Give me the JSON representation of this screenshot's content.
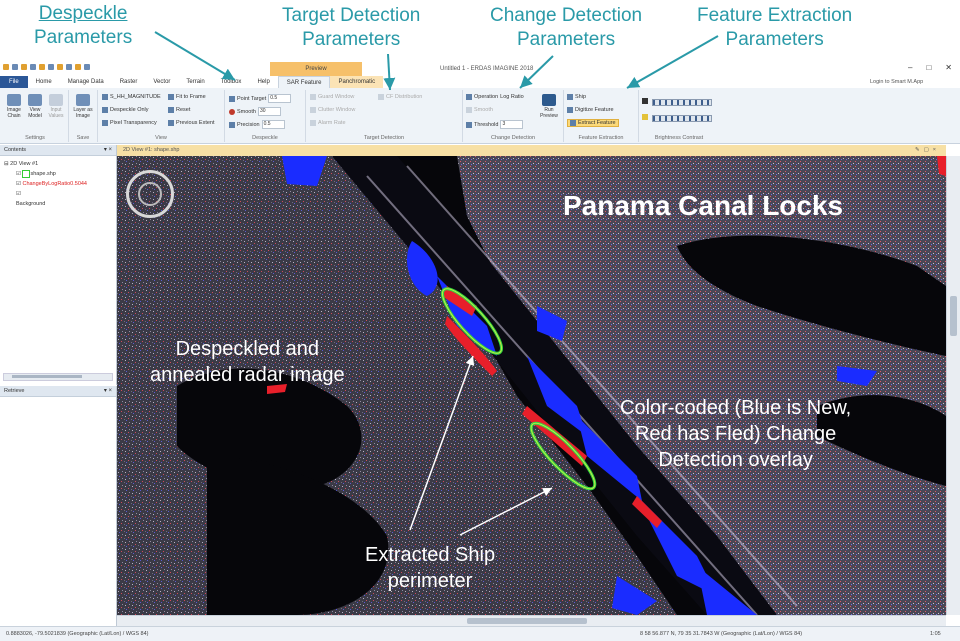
{
  "callouts": {
    "despeckle": [
      "Despeckle",
      "Parameters"
    ],
    "target": [
      "Target Detection",
      "Parameters"
    ],
    "change": [
      "Change Detection",
      "Parameters"
    ],
    "feature": [
      "Feature Extraction",
      "Parameters"
    ]
  },
  "window": {
    "context_tab": "Preview",
    "title": "Untitled 1 - ERDAS IMAGINE 2018",
    "sign_in": "Login to Smart M.App"
  },
  "tabs": [
    "File",
    "Home",
    "Manage Data",
    "Raster",
    "Vector",
    "Terrain",
    "Toolbox",
    "Help",
    "SAR Feature",
    "Panchromatic"
  ],
  "ribbon": {
    "settings": {
      "label": "Settings",
      "buttons": [
        "Image Chain",
        "View Model",
        "Input Values"
      ]
    },
    "save": {
      "label": "Save",
      "buttons": [
        "Layer as Image"
      ]
    },
    "view": {
      "label": "View",
      "items": [
        "S_HH_MAGNITUDE",
        "Despeckle Only",
        "Pixel Transparency",
        "Fit to Frame",
        "Reset",
        "Previous Extent"
      ]
    },
    "despeckle": {
      "label": "Despeckle",
      "items": [
        {
          "name": "Point Target",
          "value": "0.5"
        },
        {
          "name": "Smooth",
          "value": "30"
        },
        {
          "name": "Precision",
          "value": "0.5"
        }
      ]
    },
    "target_detection": {
      "label": "Target Detection",
      "items": [
        "Guard Window",
        "Clutter Window",
        "Alarm Rate",
        "CF Distribution"
      ]
    },
    "change_detection": {
      "label": "Change Detection",
      "items": [
        {
          "name": "Operation",
          "value": "Log Ratio"
        },
        {
          "name": "Smooth",
          "value": ""
        },
        {
          "name": "Threshold",
          "value": "3"
        }
      ],
      "run_preview": "Run Preview"
    },
    "feature_extraction": {
      "label": "Feature Extraction",
      "items": [
        "Ship",
        "Digitize Feature",
        "Extract Feature"
      ]
    },
    "brightness": {
      "label": "Brightness Contrast"
    }
  },
  "contents_panel": {
    "title": "Contents",
    "tree": [
      "2D View #1",
      "shape.shp",
      "ChangeByLogRatio0.5044",
      "",
      "Background"
    ]
  },
  "retrieve_panel": {
    "title": "Retrieve"
  },
  "view_header": "2D View #1: shape.shp",
  "map": {
    "title": "Panama Canal Locks",
    "despeckled": [
      "Despeckled and",
      "annealed radar image"
    ],
    "colorcoded": [
      "Color-coded (Blue is New,",
      "Red has Fled) Change",
      "Detection overlay"
    ],
    "ship": [
      "Extracted Ship",
      "perimeter"
    ]
  },
  "status": {
    "left": "0.8883026, -79.5021839 (Geographic (Lat/Lon) / WGS 84)",
    "right": "8 58 56.877 N, 79 35 31.7843 W (Geographic (Lat/Lon) / WGS 84)",
    "zoom": "1:05"
  }
}
